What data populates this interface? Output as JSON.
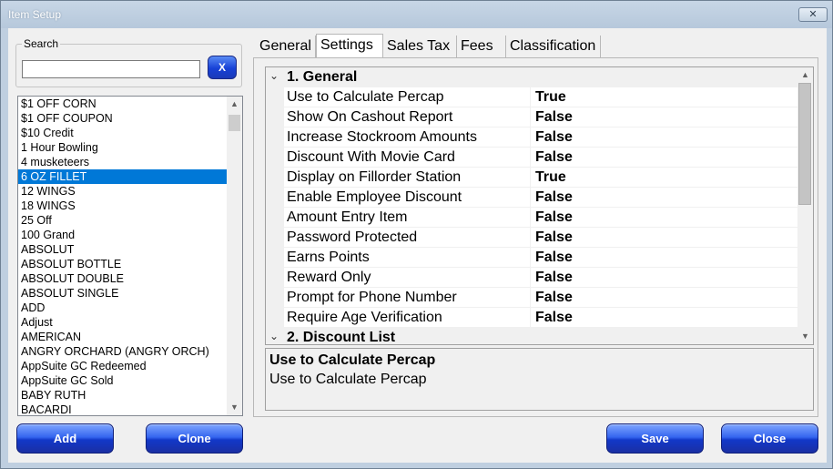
{
  "window": {
    "title": "Item Setup",
    "close_glyph": "✕"
  },
  "search": {
    "legend": "Search",
    "value": "",
    "placeholder": "",
    "clear_label": "X"
  },
  "items": [
    "$1 OFF CORN",
    "$1 OFF COUPON",
    "$10 Credit",
    "1 Hour Bowling",
    "4 musketeers",
    "6 OZ FILLET",
    "12 WINGS",
    "18 WINGS",
    "25 Off",
    "100 Grand",
    "ABSOLUT",
    "ABSOLUT BOTTLE",
    "ABSOLUT DOUBLE",
    "ABSOLUT SINGLE",
    "ADD",
    "Adjust",
    "AMERICAN",
    "ANGRY ORCHARD (ANGRY ORCH)",
    "AppSuite GC Redeemed",
    "AppSuite GC Sold",
    "BABY RUTH",
    "BACARDI"
  ],
  "selected_item_index": 5,
  "buttons": {
    "add": "Add",
    "clone": "Clone",
    "save": "Save",
    "close": "Close"
  },
  "tabs": [
    {
      "label": "General",
      "active": false
    },
    {
      "label": "Settings",
      "active": true
    },
    {
      "label": "Sales Tax",
      "active": false
    },
    {
      "label": "Fees",
      "active": false
    },
    {
      "label": "Classification",
      "active": false
    }
  ],
  "property_grid": {
    "category_general": "1. General",
    "category_discount": "2. Discount List",
    "properties": [
      {
        "name": "Use to Calculate Percap",
        "value": "True"
      },
      {
        "name": "Show On Cashout Report",
        "value": "False"
      },
      {
        "name": "Increase Stockroom Amounts",
        "value": "False"
      },
      {
        "name": "Discount With Movie Card",
        "value": "False"
      },
      {
        "name": "Display on Fillorder Station",
        "value": "True"
      },
      {
        "name": "Enable Employee Discount",
        "value": "False"
      },
      {
        "name": "Amount Entry Item",
        "value": "False"
      },
      {
        "name": "Password Protected",
        "value": "False"
      },
      {
        "name": "Earns Points",
        "value": "False"
      },
      {
        "name": "Reward Only",
        "value": "False"
      },
      {
        "name": "Prompt for Phone Number",
        "value": "False"
      },
      {
        "name": "Require Age Verification",
        "value": "False"
      }
    ]
  },
  "description": {
    "title": "Use to Calculate Percap",
    "text": "Use to Calculate Percap"
  },
  "icons": {
    "chevron": "chevron-down-icon",
    "scroll_up": "▲",
    "scroll_down": "▼"
  }
}
